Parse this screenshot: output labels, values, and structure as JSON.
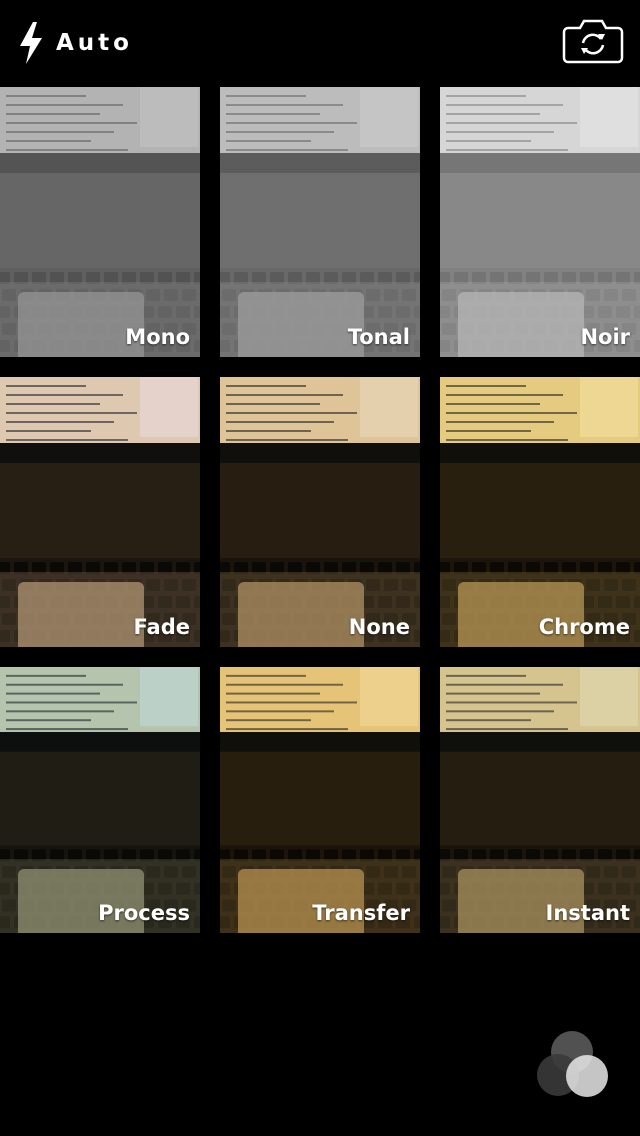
{
  "header": {
    "flash_label": "Auto",
    "flash_icon": "lightning-bolt-icon",
    "switch_camera_icon": "camera-rotate-icon"
  },
  "filters": [
    {
      "label": "Mono",
      "tint": "#8a8a8a",
      "mode": "grayscale"
    },
    {
      "label": "Tonal",
      "tint": "#9a9a9a",
      "mode": "grayscale"
    },
    {
      "label": "Noir",
      "tint": "#c8c8c8",
      "mode": "grayscale"
    },
    {
      "label": "Fade",
      "tint": "#d9b8a8",
      "mode": "color"
    },
    {
      "label": "None",
      "tint": "#d8b070",
      "mode": "color"
    },
    {
      "label": "Chrome",
      "tint": "#e8c040",
      "mode": "color"
    },
    {
      "label": "Process",
      "tint": "#8ab0a0",
      "mode": "color"
    },
    {
      "label": "Transfer",
      "tint": "#e8b030",
      "mode": "color"
    },
    {
      "label": "Instant",
      "tint": "#c8b060",
      "mode": "color"
    }
  ],
  "footer": {
    "filters_icon": "three-circles-filter-icon"
  }
}
